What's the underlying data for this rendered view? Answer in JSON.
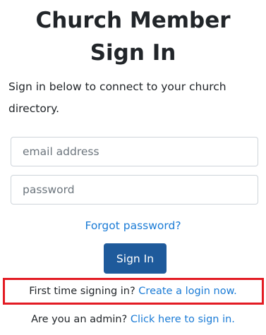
{
  "header": {
    "title_line1": "Church Member",
    "title_line2": "Sign In"
  },
  "intro_text": "Sign in below to connect to your church directory.",
  "form": {
    "email_placeholder": "email address",
    "password_placeholder": "password",
    "forgot_label": "Forgot password?",
    "signin_label": "Sign In"
  },
  "first_time": {
    "prefix": "First time signing in?",
    "link_label": "Create a login now."
  },
  "admin": {
    "prefix": "Are you an admin?",
    "link_label": "Click here to sign in."
  },
  "colors": {
    "link": "#1a7bd6",
    "primary_button": "#1e5a9b",
    "highlight_border": "#e31b23"
  }
}
